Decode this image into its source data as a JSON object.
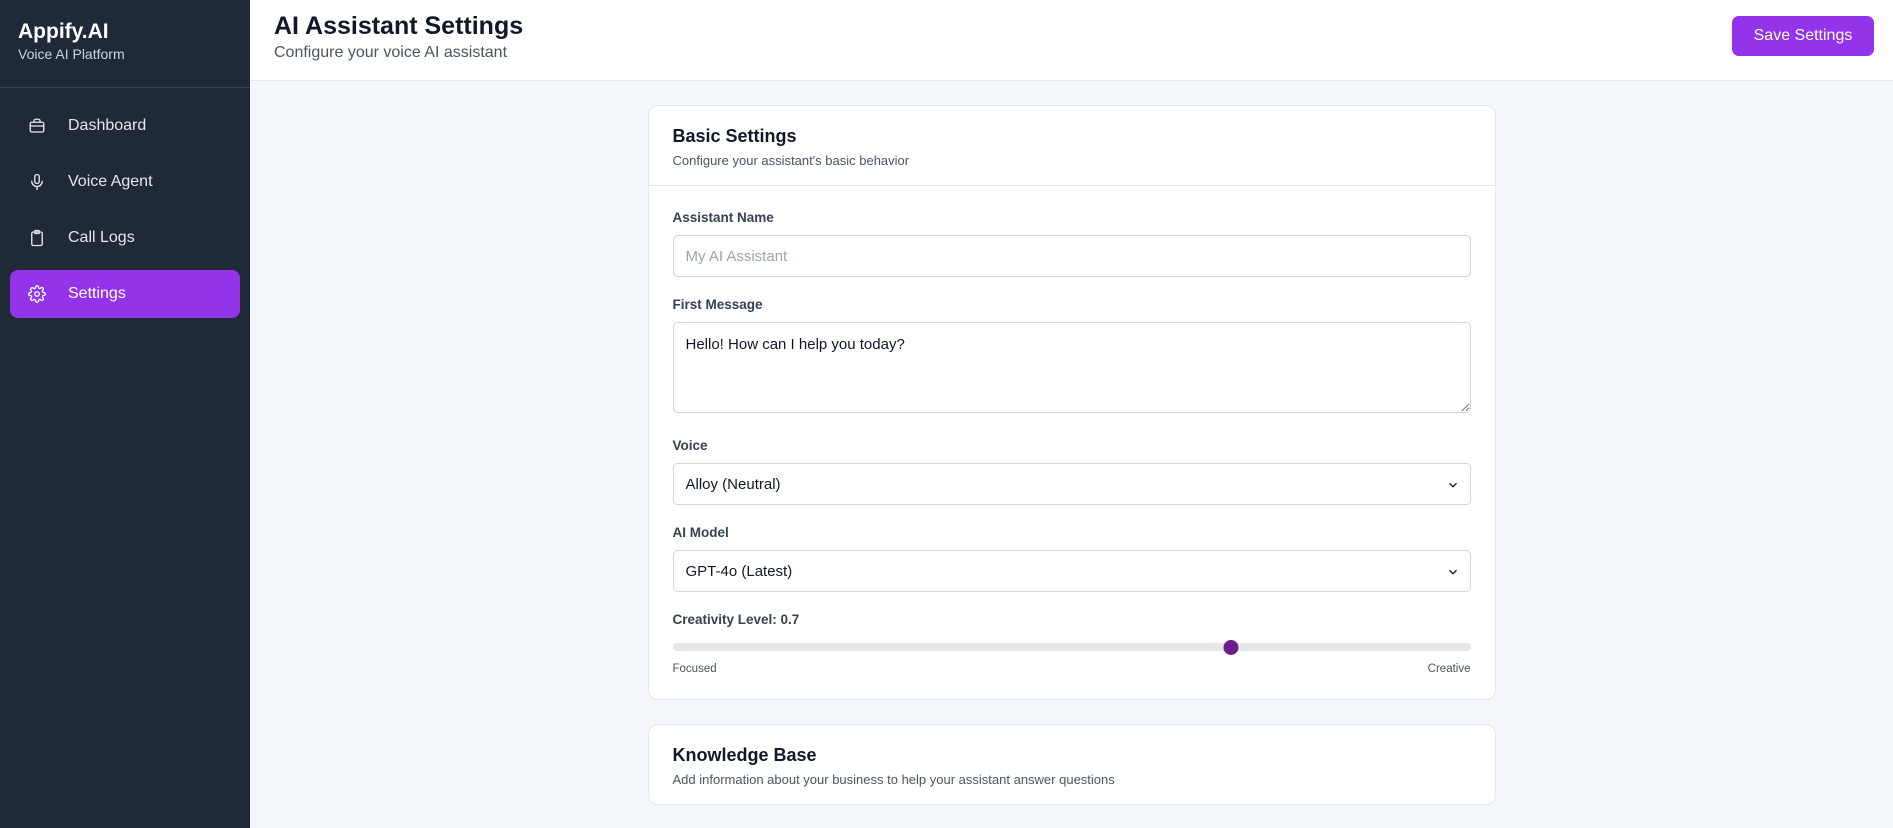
{
  "brand": {
    "name": "Appify.AI",
    "subtitle": "Voice AI Platform"
  },
  "sidebar": {
    "items": [
      {
        "label": "Dashboard",
        "icon": "briefcase-icon",
        "active": false
      },
      {
        "label": "Voice Agent",
        "icon": "microphone-icon",
        "active": false
      },
      {
        "label": "Call Logs",
        "icon": "clipboard-icon",
        "active": false
      },
      {
        "label": "Settings",
        "icon": "gear-icon",
        "active": true
      }
    ]
  },
  "header": {
    "title": "AI Assistant Settings",
    "subtitle": "Configure your voice AI assistant",
    "save_label": "Save Settings"
  },
  "basic_settings": {
    "title": "Basic Settings",
    "description": "Configure your assistant's basic behavior",
    "assistant_name": {
      "label": "Assistant Name",
      "value": "",
      "placeholder": "My AI Assistant"
    },
    "first_message": {
      "label": "First Message",
      "value": "Hello! How can I help you today?"
    },
    "voice": {
      "label": "Voice",
      "selected": "Alloy (Neutral)"
    },
    "ai_model": {
      "label": "AI Model",
      "selected": "GPT-4o (Latest)"
    },
    "creativity": {
      "label": "Creativity Level: 0.7",
      "value": 0.7,
      "min": 0,
      "max": 1,
      "min_label": "Focused",
      "max_label": "Creative"
    }
  },
  "knowledge_base": {
    "title": "Knowledge Base",
    "description": "Add information about your business to help your assistant answer questions"
  },
  "colors": {
    "sidebar_bg": "#1f2937",
    "accent": "#9333ea",
    "slider_thumb": "#6b1d8f",
    "page_bg": "#f3f6fa"
  }
}
